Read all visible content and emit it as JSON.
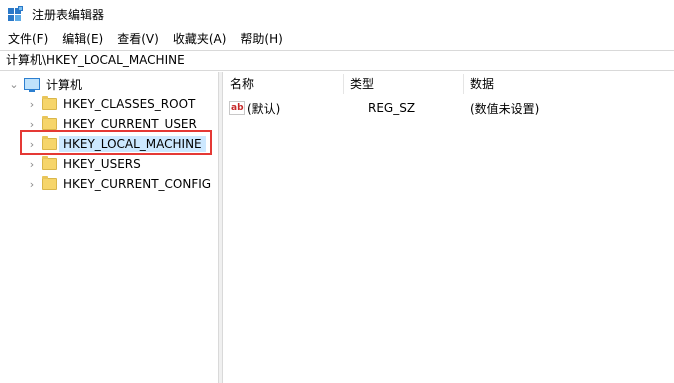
{
  "window": {
    "title": "注册表编辑器"
  },
  "menu": [
    {
      "label": "文件(F)"
    },
    {
      "label": "编辑(E)"
    },
    {
      "label": "查看(V)"
    },
    {
      "label": "收藏夹(A)"
    },
    {
      "label": "帮助(H)"
    }
  ],
  "address": {
    "path": "计算机\\HKEY_LOCAL_MACHINE"
  },
  "tree": {
    "root": {
      "label": "计算机",
      "icon": "computer-icon",
      "expanded": true
    },
    "children": [
      {
        "label": "HKEY_CLASSES_ROOT",
        "selected": false
      },
      {
        "label": "HKEY_CURRENT_USER",
        "selected": false
      },
      {
        "label": "HKEY_LOCAL_MACHINE",
        "selected": true
      },
      {
        "label": "HKEY_USERS",
        "selected": false
      },
      {
        "label": "HKEY_CURRENT_CONFIG",
        "selected": false
      }
    ]
  },
  "list": {
    "columns": [
      "名称",
      "类型",
      "数据"
    ],
    "rows": [
      {
        "name": "(默认)",
        "type": "REG_SZ",
        "data": "(数值未设置)",
        "icon": "string-value-icon"
      }
    ]
  },
  "colors": {
    "selection": "#cce8ff",
    "highlight_box": "#e53935",
    "folder": "#f6d56a"
  }
}
